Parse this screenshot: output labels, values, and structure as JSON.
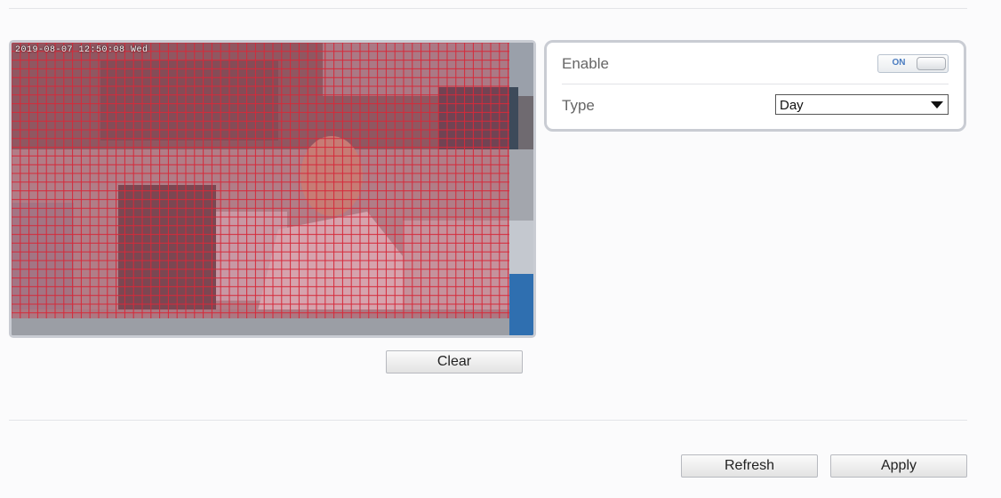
{
  "video": {
    "osd_text": "2019-08-07 12:50:08 Wed",
    "grid_color": "#d62a3a",
    "mask_color": "#c93a49"
  },
  "buttons": {
    "clear": "Clear",
    "refresh": "Refresh",
    "apply": "Apply"
  },
  "settings": {
    "enable_label": "Enable",
    "enable_toggle": "ON",
    "type_label": "Type",
    "type_value": "Day"
  }
}
